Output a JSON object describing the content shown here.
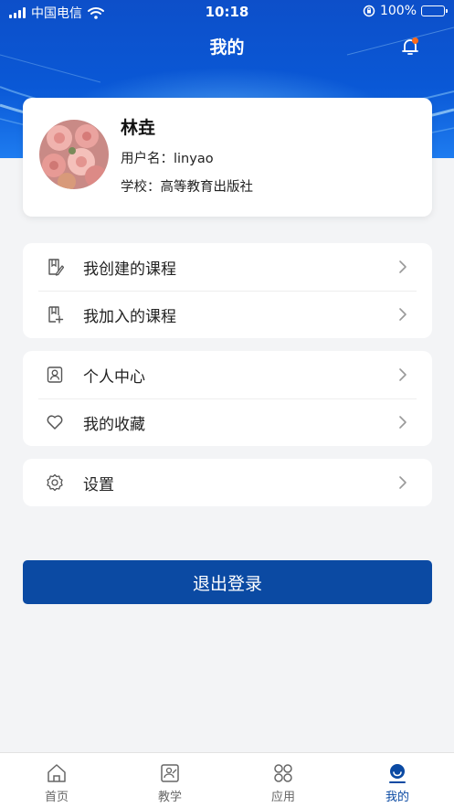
{
  "status_bar": {
    "carrier": "中国电信",
    "time": "10:18",
    "battery": "100%",
    "battery_level": 1.0
  },
  "header": {
    "title": "我的",
    "notification_icon": "bell-icon",
    "has_unread": true
  },
  "profile": {
    "name": "林垚",
    "username_label": "用户名：",
    "username": "linyao",
    "school_label": "学校：",
    "school": "高等教育出版社"
  },
  "menu_groups": [
    {
      "items": [
        {
          "label": "我创建的课程",
          "icon": "book-edit-icon"
        },
        {
          "label": "我加入的课程",
          "icon": "book-add-icon"
        }
      ]
    },
    {
      "items": [
        {
          "label": "个人中心",
          "icon": "person-icon"
        },
        {
          "label": "我的收藏",
          "icon": "heart-icon"
        }
      ]
    },
    {
      "items": [
        {
          "label": "设置",
          "icon": "gear-icon"
        }
      ]
    }
  ],
  "logout_label": "退出登录",
  "tabs": [
    {
      "label": "首页",
      "icon": "home-icon",
      "active": false
    },
    {
      "label": "教学",
      "icon": "teaching-icon",
      "active": false
    },
    {
      "label": "应用",
      "icon": "apps-icon",
      "active": false
    },
    {
      "label": "我的",
      "icon": "profile-icon",
      "active": true
    }
  ],
  "colors": {
    "primary": "#0b4aa3",
    "header_blue": "#0a58d6",
    "badge_orange": "#ff6a1a",
    "background": "#f3f4f6"
  }
}
